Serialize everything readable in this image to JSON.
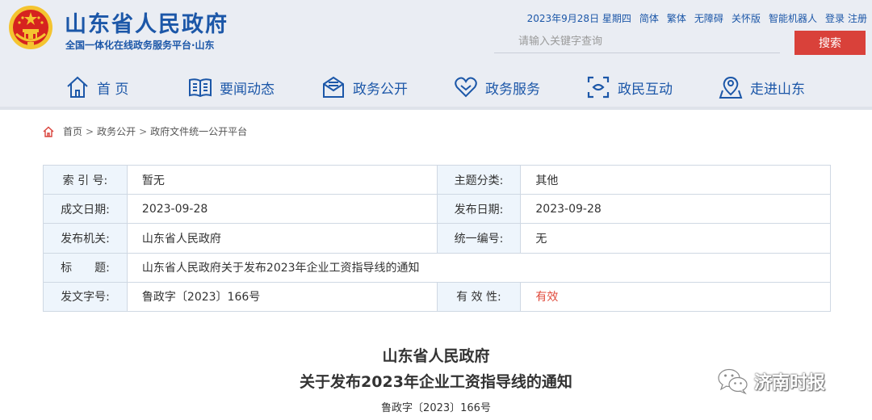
{
  "header": {
    "site_title": "山东省人民政府",
    "site_subtitle": "全国一体化在线政务服务平台·山东",
    "date": "2023年9月28日 星期四",
    "links": [
      "简体",
      "繁体",
      "无障碍",
      "关怀版",
      "智能机器人",
      "登录",
      "注册"
    ],
    "search_placeholder": "请输入关键字查询",
    "search_button": "搜索",
    "accent_color": "#1c57a8",
    "search_button_color": "#d9413a"
  },
  "nav": {
    "items": [
      {
        "label": "首 页",
        "icon": "home-icon"
      },
      {
        "label": "要闻动态",
        "icon": "news-book-icon"
      },
      {
        "label": "政务公开",
        "icon": "envelope-icon"
      },
      {
        "label": "政务服务",
        "icon": "heart-icon"
      },
      {
        "label": "政民互动",
        "icon": "interaction-icon"
      },
      {
        "label": "走进山东",
        "icon": "map-pin-icon"
      }
    ]
  },
  "breadcrumb": {
    "items": [
      "首页",
      "政务公开",
      "政府文件统一公开平台"
    ],
    "separator": ">"
  },
  "info_table": {
    "rows": [
      [
        {
          "key": "索 引 号:",
          "value": "暂无"
        },
        {
          "key": "主题分类:",
          "value": "其他"
        }
      ],
      [
        {
          "key": "成文日期:",
          "value": "2023-09-28"
        },
        {
          "key": "发布日期:",
          "value": "2023-09-28"
        }
      ],
      [
        {
          "key": "发布机关:",
          "value": "山东省人民政府"
        },
        {
          "key": "统一编号:",
          "value": "无"
        }
      ],
      [
        {
          "key": "标　　题:",
          "value": "山东省人民政府关于发布2023年企业工资指导线的通知"
        }
      ],
      [
        {
          "key": "发文字号:",
          "value": "鲁政字〔2023〕166号"
        },
        {
          "key": "有 效 性:",
          "value": "有效"
        }
      ]
    ],
    "valid_color": "#e04b3c"
  },
  "document": {
    "title_line1": "山东省人民政府",
    "title_line2": "关于发布2023年企业工资指导线的通知",
    "doc_number": "鲁政字〔2023〕166号"
  },
  "watermark": {
    "text": "济南时报",
    "icon": "wechat-icon"
  }
}
